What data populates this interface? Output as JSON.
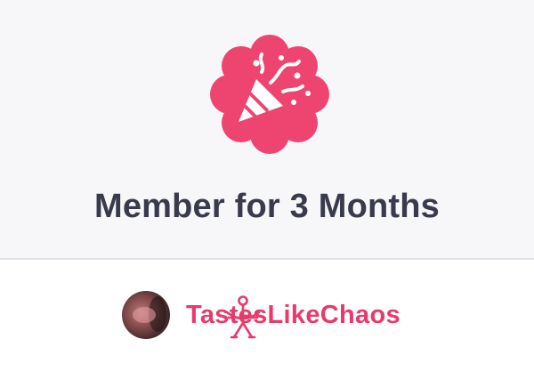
{
  "milestone": {
    "title": "Member for 3 Months",
    "badge_icon": "party-popper-icon",
    "badge_color": "#ee4470",
    "background": "#f7f7f9"
  },
  "profile": {
    "username": "TastesLikeChaos",
    "username_color": "#e83a6b",
    "avatar_icon": "avatar",
    "overlay_icon": "archer-icon"
  }
}
